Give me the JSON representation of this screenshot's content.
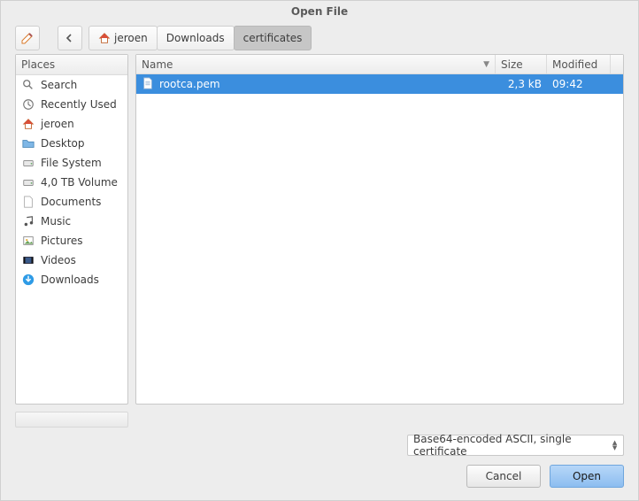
{
  "window": {
    "title": "Open File"
  },
  "breadcrumb": {
    "home_label": "jeroen",
    "items": [
      "Downloads",
      "certificates"
    ],
    "active_index": 1
  },
  "places": {
    "header": "Places",
    "items": [
      {
        "icon": "search-icon",
        "label": "Search"
      },
      {
        "icon": "clock-icon",
        "label": "Recently Used"
      },
      {
        "icon": "home-icon",
        "label": "jeroen"
      },
      {
        "icon": "folder-icon",
        "label": "Desktop"
      },
      {
        "icon": "drive-icon",
        "label": "File System"
      },
      {
        "icon": "drive-icon",
        "label": "4,0 TB Volume"
      },
      {
        "icon": "file-icon",
        "label": "Documents"
      },
      {
        "icon": "music-icon",
        "label": "Music"
      },
      {
        "icon": "pictures-icon",
        "label": "Pictures"
      },
      {
        "icon": "video-icon",
        "label": "Videos"
      },
      {
        "icon": "download-icon",
        "label": "Downloads"
      }
    ]
  },
  "columns": {
    "name": "Name",
    "size": "Size",
    "modified": "Modified"
  },
  "files": [
    {
      "icon": "textfile-icon",
      "name": "rootca.pem",
      "size": "2,3 kB",
      "modified": "09:42",
      "selected": true
    }
  ],
  "filter": {
    "value": "Base64-encoded ASCII, single certificate"
  },
  "buttons": {
    "cancel": "Cancel",
    "open": "Open"
  }
}
